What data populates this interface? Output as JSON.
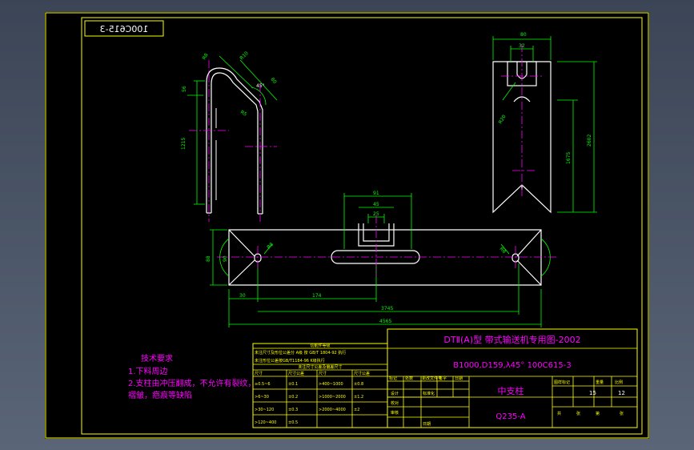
{
  "drawing_number_stamp": "100C615-3",
  "title_block": {
    "series_title": "DTⅡ(A)型  带式输送机专用图-2002",
    "spec": "B1000,D159,λ45°  100C615-3",
    "part_name": "中支柱",
    "material": "Q235-A",
    "stage_label": "图样标记",
    "weight_label": "重量",
    "scale_label": "比例",
    "sheet_count": "15",
    "scale_value": "12",
    "sheet_total_label": "共",
    "sheet_label": "张",
    "sheet_of_label": "第",
    "sheet_of_label2": "张",
    "rev_headers": [
      "标记",
      "处数",
      "更改文件号",
      "签字",
      "日期"
    ],
    "sign_rows": [
      "设计",
      "校对",
      "审核"
    ],
    "approve_label": "标准化",
    "approve_label2": "日期"
  },
  "tolerance_table": {
    "header": "切削件等级",
    "note_line1": "未注尺寸及形位公差分 A级 按 GB/T 1804-92 执行",
    "note_line2": "未注形位公差按GB/T1184-96 K级执行",
    "subheader": "未注尺寸公差及偏差尺寸",
    "col_headers": [
      "尺寸",
      "尺寸公差",
      "尺寸",
      "尺寸公差"
    ],
    "rows": [
      [
        "≥0.5~6",
        "±0.1",
        ">400~1000",
        "±0.8"
      ],
      [
        ">6~30",
        "±0.2",
        ">1000~2000",
        "±1.2"
      ],
      [
        ">30~120",
        "±0.3",
        ">2000~4000",
        "±2"
      ],
      [
        ">120~400",
        "±0.5",
        "",
        ""
      ]
    ]
  },
  "tech_notes": {
    "title": "技术要求",
    "lines": [
      "1.下料周边",
      "2.支柱由冲压翻成，不允许有裂纹，",
      "   褶皱，疤痕等缺陷"
    ]
  },
  "dimensions": {
    "bent_view": [
      "R8",
      "R10",
      "80",
      "45°",
      "R5",
      "56",
      "1215"
    ],
    "side_view": [
      "80",
      "32",
      "R20",
      "2602",
      "1675"
    ],
    "plan_view": [
      "91",
      "45",
      "25",
      "R8",
      "R8",
      "88",
      "90",
      "174",
      "30",
      "3745",
      "4565"
    ]
  },
  "colors": {
    "frame": "#ffff00",
    "part": "#ffffff",
    "dimension": "#00ff00",
    "centerline": "#ff00ff",
    "text_magenta": "#ff00ff",
    "text_yellow": "#ffff00"
  }
}
